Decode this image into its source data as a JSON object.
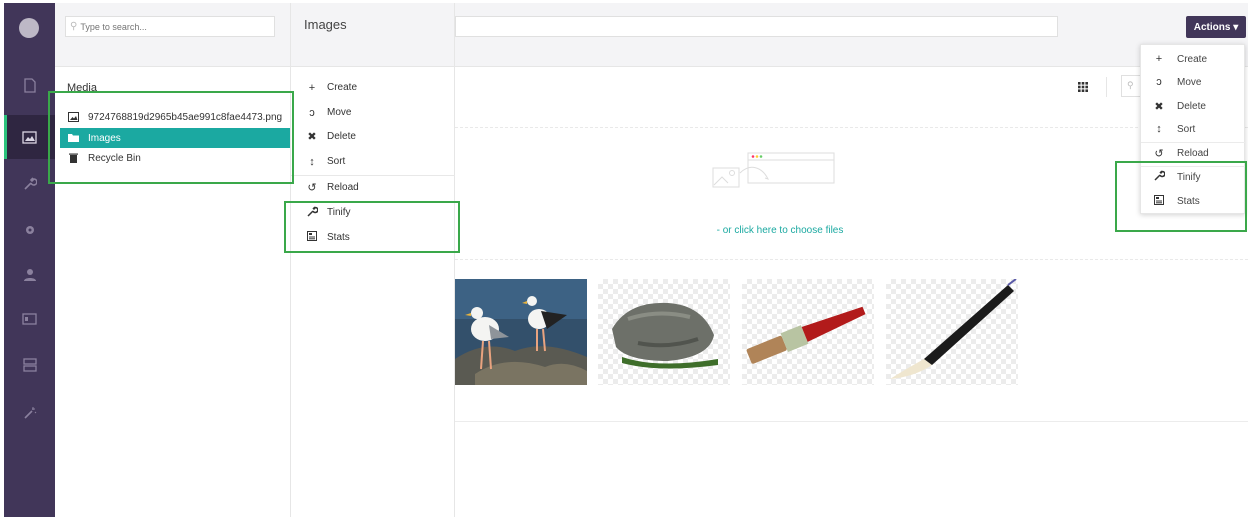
{
  "tree": {
    "search_placeholder": "Type to search...",
    "root_label": "Media",
    "nodes": [
      {
        "label": "9724768819d2965b45ae991c8fae4473.png",
        "icon": "image-icon"
      },
      {
        "label": "Images",
        "icon": "folder-icon"
      },
      {
        "label": "Recycle Bin",
        "icon": "trash-icon"
      }
    ]
  },
  "context_menu": {
    "title": "Images",
    "items": [
      {
        "label": "Create",
        "icon": "plus-icon"
      },
      {
        "label": "Move",
        "icon": "move-icon"
      },
      {
        "label": "Delete",
        "icon": "delete-icon"
      },
      {
        "label": "Sort",
        "icon": "sort-icon"
      },
      {
        "label": "Reload",
        "icon": "reload-icon"
      },
      {
        "label": "Tinify",
        "icon": "wrench-icon"
      },
      {
        "label": "Stats",
        "icon": "stats-icon"
      }
    ]
  },
  "main": {
    "actions_label": "Actions ▾",
    "choose_files_link": "- or click here to choose files"
  },
  "actions_menu": {
    "items": [
      {
        "label": "Create",
        "icon": "plus-icon"
      },
      {
        "label": "Move",
        "icon": "move-icon"
      },
      {
        "label": "Delete",
        "icon": "delete-icon"
      },
      {
        "label": "Sort",
        "icon": "sort-icon"
      },
      {
        "label": "Reload",
        "icon": "reload-icon"
      },
      {
        "label": "Tinify",
        "icon": "wrench-icon"
      },
      {
        "label": "Stats",
        "icon": "stats-icon"
      }
    ]
  },
  "colors": {
    "rail": "#413659",
    "selected": "#1ba9a1",
    "highlight": "#3aa84a",
    "link": "#1ba9a1"
  }
}
